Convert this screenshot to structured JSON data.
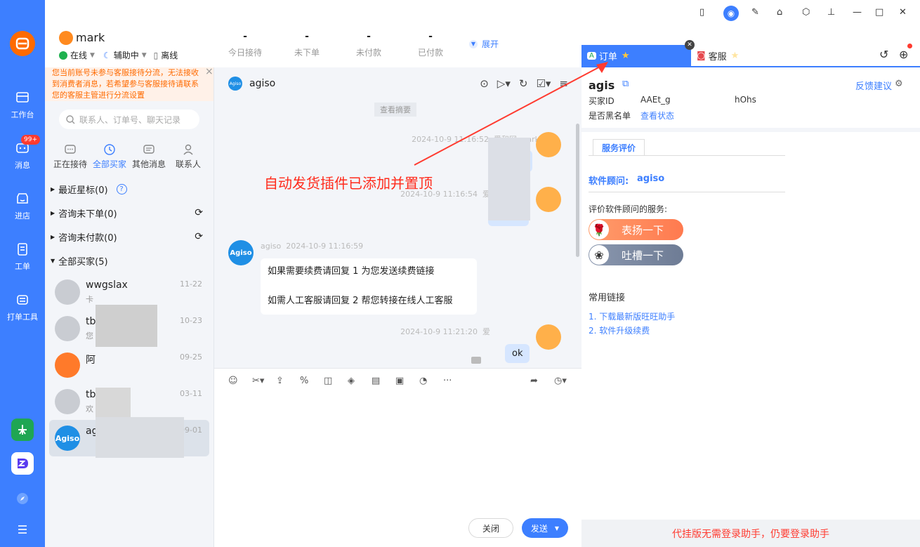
{
  "nav": {
    "items": [
      {
        "label": "工作台",
        "icon": "workbench-icon"
      },
      {
        "label": "消息",
        "icon": "message-icon",
        "badge": "99+"
      },
      {
        "label": "进店",
        "icon": "store-icon"
      },
      {
        "label": "工单",
        "icon": "ticket-icon"
      },
      {
        "label": "打单工具",
        "icon": "print-icon"
      }
    ]
  },
  "account": {
    "name": "mark",
    "status_online": "在线",
    "status_assist": "辅助中",
    "status_offline": "离线"
  },
  "stats": [
    {
      "value": "-",
      "label": "今日接待"
    },
    {
      "value": "-",
      "label": "未下单"
    },
    {
      "value": "-",
      "label": "未付款"
    },
    {
      "value": "-",
      "label": "已付款"
    }
  ],
  "expand_label": "展开",
  "warning": "您当前账号未参与客服接待分流，无法接收到消费者消息，若希望参与客服接待请联系您的客服主管进行分流设置",
  "search_placeholder": "联系人、订单号、聊天记录",
  "contact_tabs": [
    {
      "label": "正在接待"
    },
    {
      "label": "全部买家"
    },
    {
      "label": "其他消息"
    },
    {
      "label": "联系人"
    }
  ],
  "groups": [
    {
      "label": "最近星标(0)"
    },
    {
      "label": "咨询未下单(0)"
    },
    {
      "label": "咨询未付款(0)"
    },
    {
      "label": "全部买家(5)"
    }
  ],
  "contacts": [
    {
      "name": "wwgslax",
      "date": "11-22",
      "preview": "卡"
    },
    {
      "name": "tb",
      "date": "10-23",
      "preview": "您"
    },
    {
      "name": "阿",
      "date": "09-25",
      "preview": ""
    },
    {
      "name": "tb",
      "date": "03-11",
      "preview": "欢"
    },
    {
      "name": "ag",
      "date": "09-01",
      "preview": ""
    }
  ],
  "chat": {
    "title": "agiso",
    "summary_label": "查看摘要",
    "messages": [
      {
        "sender": "爱和网:mark",
        "time": "2024-10-9 11:16:52",
        "text": "测"
      },
      {
        "sender": "爱",
        "time": "2024-10-9 11:16:54",
        "text": ""
      },
      {
        "sender": "agiso",
        "time": "2024-10-9 11:16:59",
        "line1": "如果需要续费请回复 1   为您发送续费链接",
        "line2": "如需人工客服请回复 2   帮您转接在线人工客服"
      },
      {
        "sender": "爱",
        "time": "2024-10-9 11:21:20",
        "text": "ok"
      }
    ],
    "close_label": "关闭",
    "send_label": "发送"
  },
  "annotation": "自动发货插件已添加并置顶",
  "right": {
    "tab_order": "订单",
    "tab_service": "客服",
    "feedback": "反馈建议",
    "buyer_title": "agis",
    "buyer_id_label": "买家ID",
    "buyer_id_value": "AAEt_g",
    "buyer_id_tail": "hOhs",
    "blacklist_label": "是否黑名单",
    "blacklist_link": "查看状态",
    "eval_tab": "服务评价",
    "advisor_label": "软件顾问:",
    "advisor_name": "agiso",
    "eval_prompt": "评价软件顾问的服务:",
    "praise": "表扬一下",
    "complain": "吐槽一下",
    "links_title": "常用链接",
    "links": [
      "1. 下载最新版旺旺助手",
      "2. 软件升级续费"
    ],
    "footer": "代挂版无需登录助手，仍要登录助手"
  }
}
